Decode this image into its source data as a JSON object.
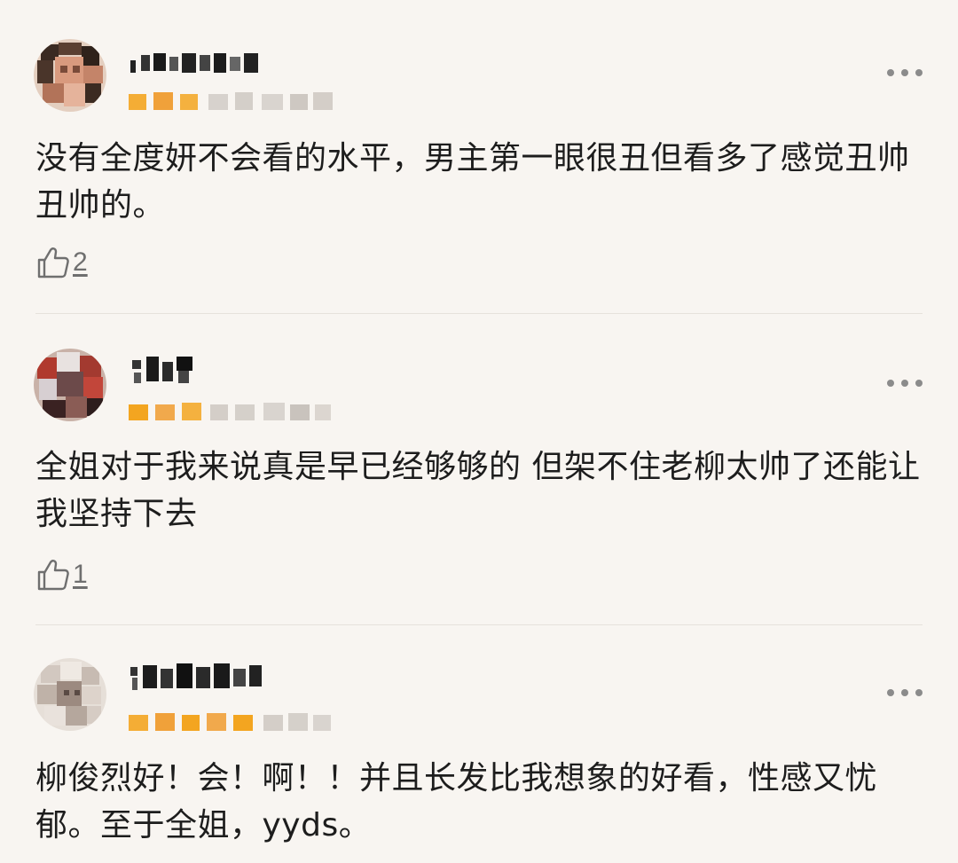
{
  "comments": [
    {
      "text": "没有全度妍不会看的水平，男主第一眼很丑但看多了感觉丑帅丑帅的。",
      "likes": "2",
      "more_icon": "more-dots-icon",
      "like_icon": "thumbs-up-icon"
    },
    {
      "text": "全姐对于我来说真是早已经够够的 但架不住老柳太帅了还能让我坚持下去",
      "likes": "1",
      "more_icon": "more-dots-icon",
      "like_icon": "thumbs-up-icon"
    },
    {
      "text": "柳俊烈好！会！啊！！并且长发比我想象的好看，性感又忧郁。至于全姐，yyds。",
      "likes": "",
      "more_icon": "more-dots-icon",
      "like_icon": "thumbs-up-icon"
    }
  ],
  "colors": {
    "background": "#f8f5f1",
    "text": "#1d1d1d",
    "muted": "#6f6f6f",
    "star": "#f3a520",
    "divider": "#e6e2dc"
  }
}
